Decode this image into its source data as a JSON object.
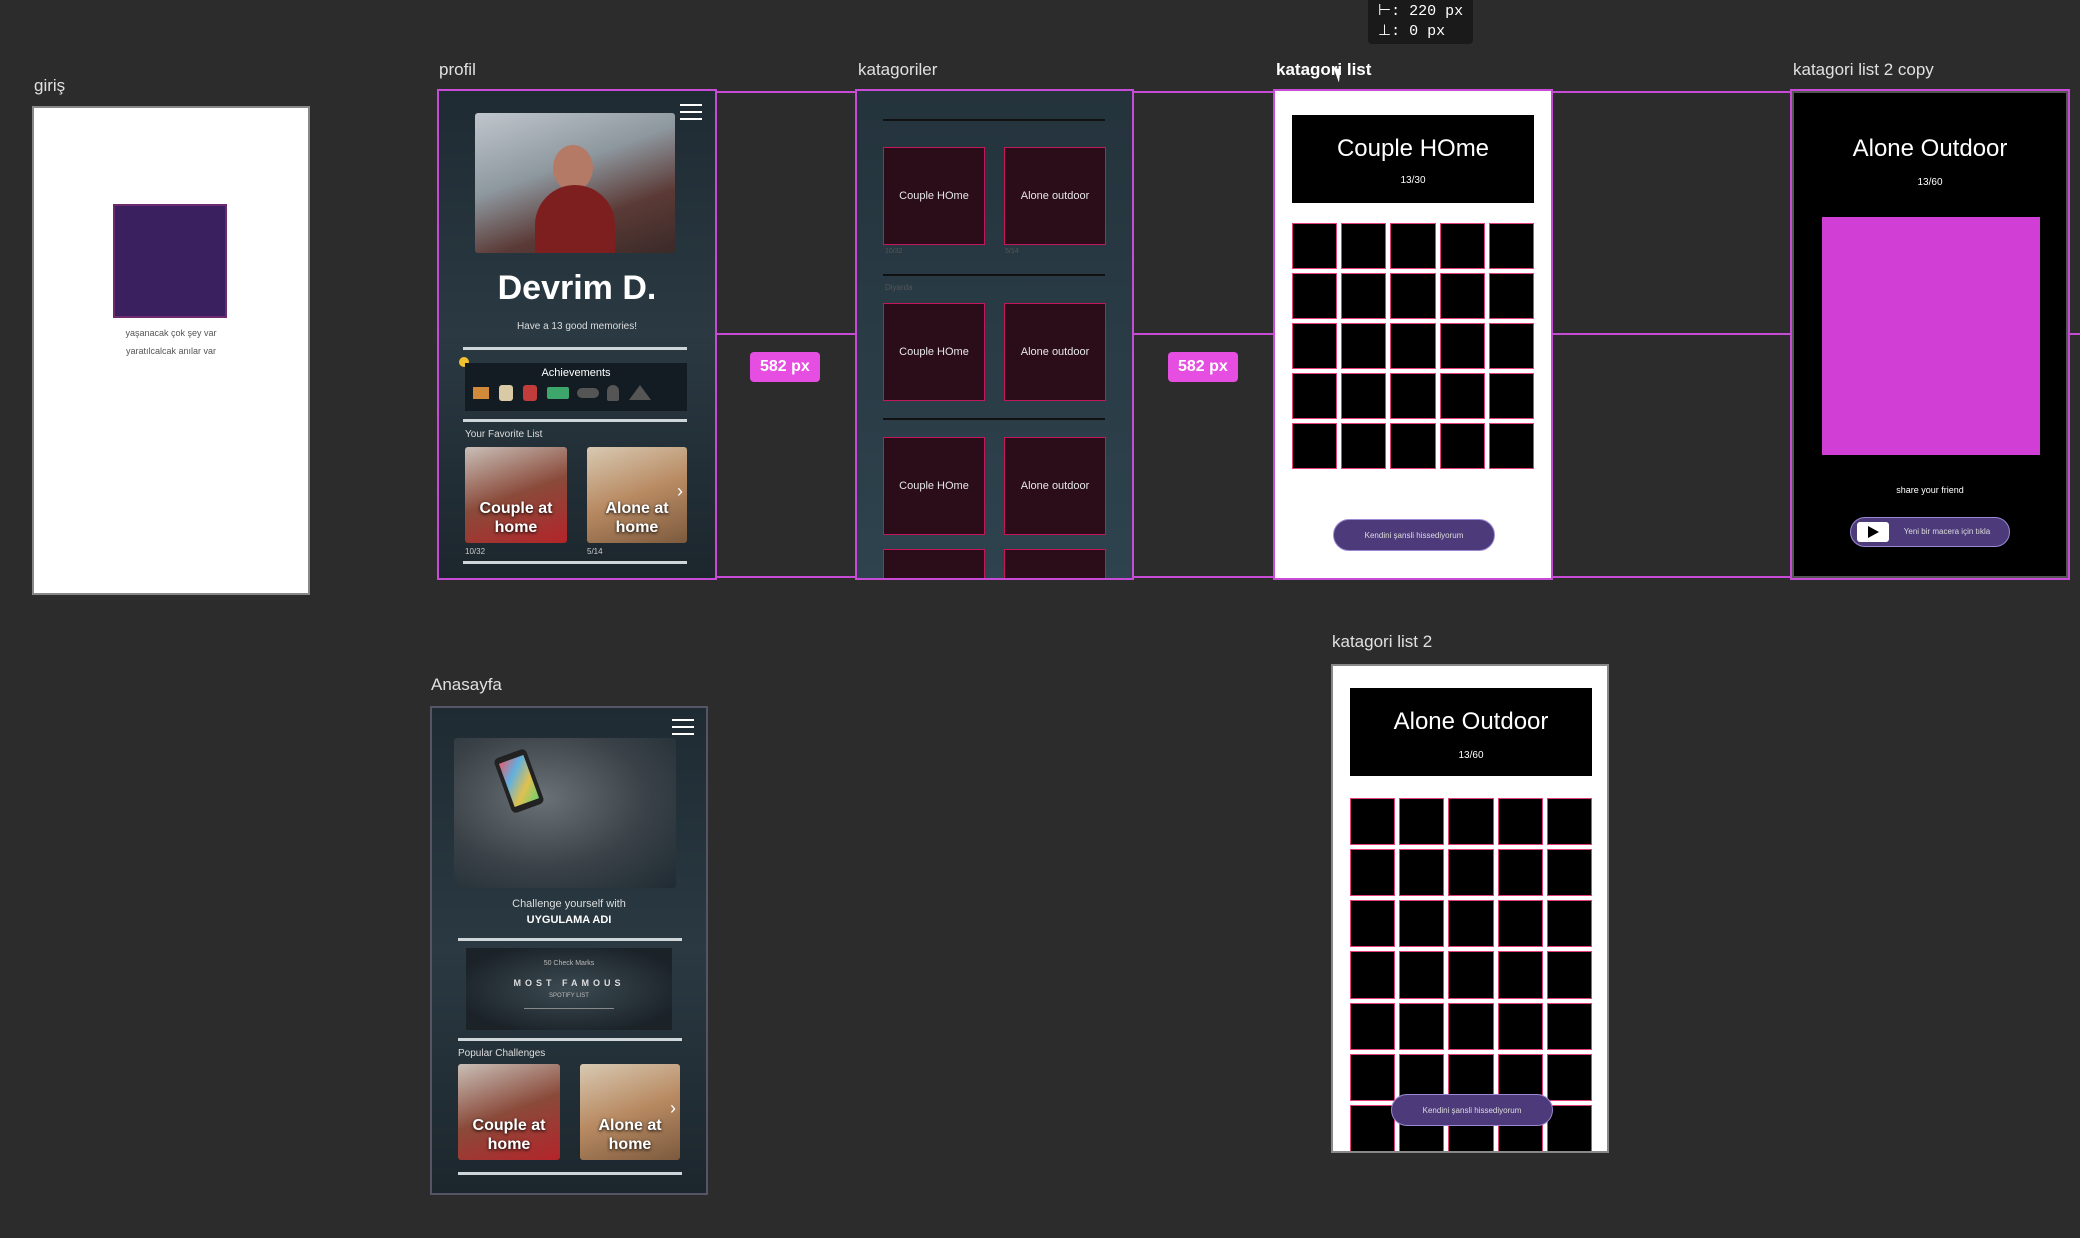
{
  "measurement": {
    "horizontal": "⊢: 220 px",
    "vertical": "⊥:    0 px"
  },
  "spacing_badges": [
    "582 px",
    "582 px"
  ],
  "frames": {
    "giris": {
      "label": "giriş",
      "text_line1": "yaşanacak çok şey var",
      "text_line2": "yaratılcalcak anılar var",
      "square_color": "#3b2060"
    },
    "profil": {
      "label": "profil",
      "name": "Devrim D.",
      "subtitle": "Have a 13 good memories!",
      "achievements_title": "Achievements",
      "favorites_title": "Your Favorite List",
      "favorites": [
        {
          "title": "Couple at home",
          "count": "10/32"
        },
        {
          "title": "Alone at home",
          "count": "5/14"
        }
      ]
    },
    "katagoriler": {
      "label": "katagoriler",
      "cards": [
        "Couple HOme",
        "Alone outdoor",
        "Couple HOme",
        "Alone outdoor",
        "Couple HOme",
        "Alone outdoor"
      ],
      "section_hint": "Diyarda",
      "small_counts": [
        "10/32",
        "5/14"
      ]
    },
    "katagori_list": {
      "label": "katagori list",
      "title": "Couple HOme",
      "count": "13/30",
      "button": "Kendini şansli hissediyorum"
    },
    "katagori_list_2_copy": {
      "label": "katagori list 2 copy",
      "title": "Alone Outdoor",
      "count": "13/60",
      "share": "share your friend",
      "button": "Yeni bir macera için tıkla",
      "accent": "#d13ed6"
    },
    "katagori_list_2": {
      "label": "katagori list 2",
      "title": "Alone Outdoor",
      "count": "13/60",
      "button": "Kendini şansli hissediyorum"
    },
    "anasayfa": {
      "label": "Anasayfa",
      "challenge_line1": "Challenge yourself with",
      "challenge_line2": "UYGULAMA ADI",
      "banner_top": "50 Check Marks",
      "banner_main": "MOST FAMOUS",
      "banner_sub": "SPOTIFY LIST",
      "popular_title": "Popular Challenges",
      "popular": [
        {
          "title": "Couple at home"
        },
        {
          "title": "Alone at home"
        }
      ]
    }
  },
  "colors": {
    "canvas": "#2c2c2c",
    "selection": "#c84bd6",
    "grid_border": "#e23e7c"
  }
}
